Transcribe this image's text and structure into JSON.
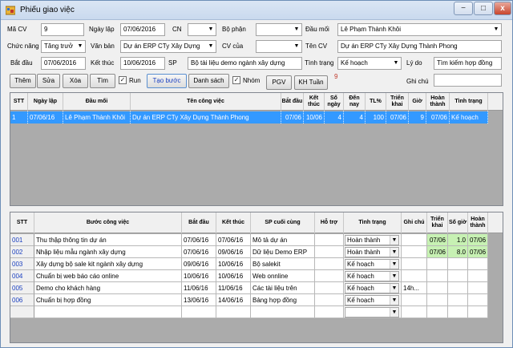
{
  "window": {
    "title": "Phiếu giao việc",
    "min": "−",
    "max": "□",
    "close": "x"
  },
  "form": {
    "ma_cv_label": "Mã CV",
    "ma_cv": "9",
    "ngay_lap_label": "Ngày lập",
    "ngay_lap": "07/06/2016",
    "cn_label": "CN",
    "cn": "",
    "bo_phan_label": "Bộ phận",
    "bo_phan": "",
    "dau_moi_label": "Đầu mối",
    "dau_moi": "Lê Phạm Thành Khôi",
    "chuc_nang_label": "Chức năng",
    "chuc_nang": "Tăng trưở",
    "van_ban_label": "Văn bản",
    "van_ban": "Dự án ERP CTy Xây Dựng",
    "cv_cua_label": "CV của",
    "cv_cua": "",
    "ten_cv_label": "Tên CV",
    "ten_cv": "Dự án ERP CTy Xây Dựng Thành Phong",
    "bat_dau_label": "Bắt đầu",
    "bat_dau": "07/06/2016",
    "ket_thuc_label": "Kết thúc",
    "ket_thuc": "10/06/2016",
    "sp_label": "SP",
    "sp": "Bộ tài liệu demo ngành xây dựng",
    "tinh_trang_label": "Tình trạng",
    "tinh_trang": "Kế hoạch",
    "ly_do_label": "Lý do",
    "ly_do": "Tìm kiếm hợp đồng",
    "ghi_chu_label": "Ghi chú",
    "ghi_chu": "",
    "count": "9"
  },
  "toolbar": {
    "them": "Thêm",
    "sua": "Sửa",
    "xoa": "Xóa",
    "tim": "Tìm",
    "run": "Run",
    "tao_buoc": "Tạo bước",
    "danh_sach": "Danh sách",
    "nhom": "Nhóm",
    "pgv": "PGV",
    "kh_tuan": "KH Tuần",
    "run_checked": true,
    "nhom_checked": true
  },
  "grid1": {
    "headers": [
      "STT",
      "Ngày lập",
      "Đầu mối",
      "Tên công việc",
      "Bắt đầu",
      "Kết thúc",
      "Số ngày",
      "Đến nay",
      "TL%",
      "Triển khai",
      "Giờ",
      "Hoàn thành",
      "Tình trạng"
    ],
    "rows": [
      [
        "1",
        "07/06/16",
        "Lê Phạm Thành Khôi",
        "Dự án ERP CTy Xây Dựng Thành Phong",
        "07/06",
        "10/06",
        "4",
        "4",
        "100",
        "07/06",
        "9",
        "07/06",
        "Kế hoạch"
      ]
    ]
  },
  "grid2": {
    "headers": [
      "STT",
      "Bước công việc",
      "Bắt đầu",
      "Kết thúc",
      "SP cuối cùng",
      "Hỗ trợ",
      "Tình trạng",
      "Ghi chú",
      "Triển khai",
      "Số giờ",
      "Hoàn thành"
    ],
    "rows": [
      {
        "stt": "001",
        "buoc": "Thu thập thông tin dự án",
        "bd": "07/06/16",
        "kt": "07/06/16",
        "sp": "Mô tả dự án",
        "ht": "",
        "tt": "Hoàn thành",
        "gc": "",
        "tk": "07/06",
        "sg": "1.0",
        "hoan": "07/06"
      },
      {
        "stt": "002",
        "buoc": "Nhập liệu mẫu ngành xây dựng",
        "bd": "07/06/16",
        "kt": "09/06/16",
        "sp": "Dữ liệu Demo ERP",
        "ht": "",
        "tt": "Hoàn thành",
        "gc": "",
        "tk": "07/06",
        "sg": "8.0",
        "hoan": "07/06"
      },
      {
        "stt": "003",
        "buoc": "Xây dựng bộ sale kit ngành xây dựng",
        "bd": "09/06/16",
        "kt": "10/06/16",
        "sp": "Bộ salekit",
        "ht": "",
        "tt": "Kế hoạch",
        "gc": "",
        "tk": "",
        "sg": "",
        "hoan": ""
      },
      {
        "stt": "004",
        "buoc": "Chuẩn bị web báo cáo online",
        "bd": "10/06/16",
        "kt": "10/06/16",
        "sp": "Web onnline",
        "ht": "",
        "tt": "Kế hoạch",
        "gc": "",
        "tk": "",
        "sg": "",
        "hoan": ""
      },
      {
        "stt": "005",
        "buoc": "Demo cho khách hàng",
        "bd": "11/06/16",
        "kt": "11/06/16",
        "sp": "Các tài liệu trên",
        "ht": "",
        "tt": "Kế hoạch",
        "gc": "14h...",
        "tk": "",
        "sg": "",
        "hoan": ""
      },
      {
        "stt": "006",
        "buoc": "Chuẩn bị hợp đồng",
        "bd": "13/06/16",
        "kt": "14/06/16",
        "sp": "Bảng hợp đồng",
        "ht": "",
        "tt": "Kế hoạch",
        "gc": "",
        "tk": "",
        "sg": "",
        "hoan": ""
      },
      {
        "stt": "",
        "buoc": "",
        "bd": "",
        "kt": "",
        "sp": "",
        "ht": "",
        "tt": "",
        "gc": "",
        "tk": "",
        "sg": "",
        "hoan": ""
      }
    ]
  }
}
